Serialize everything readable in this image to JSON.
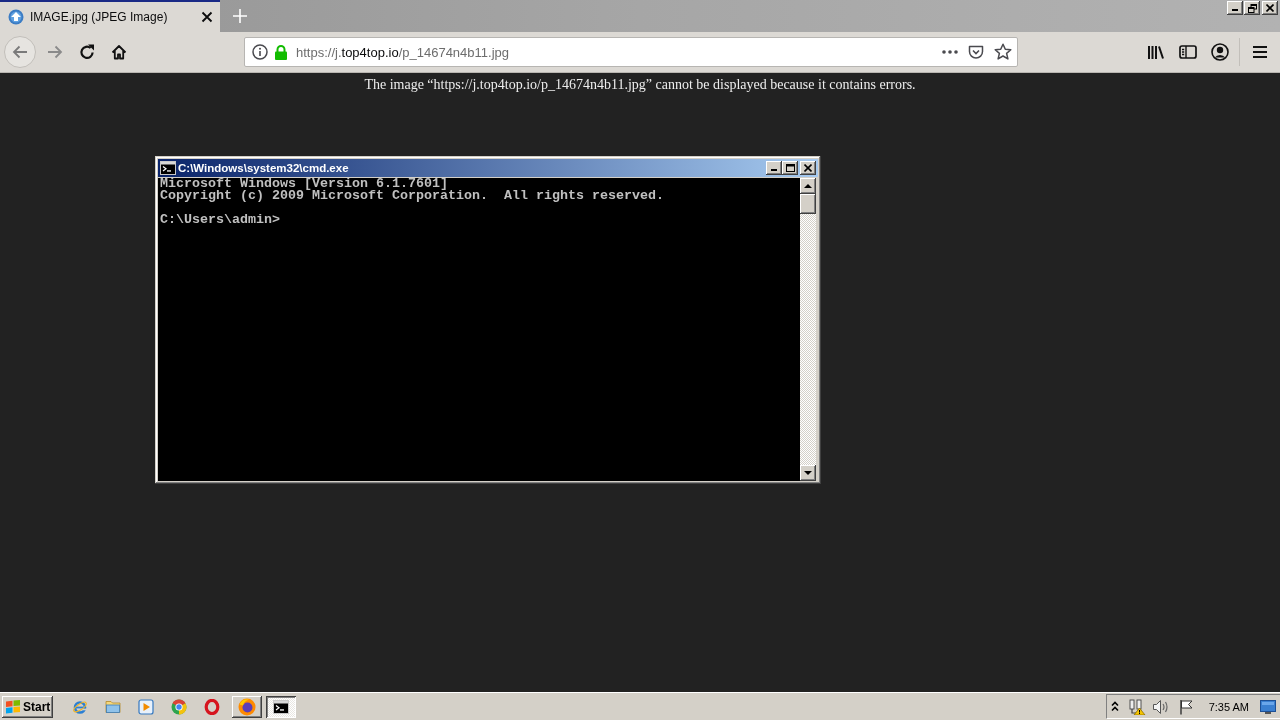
{
  "browser": {
    "tabs": [
      {
        "title": "IMAGE.jpg (JPEG Image)",
        "selected": true
      }
    ],
    "address_bar": {
      "url": {
        "before_domain": "https://j.",
        "domain": "top4top.io",
        "after_domain": "/p_14674n4b11.jpg"
      }
    }
  },
  "page": {
    "message": "The image “https://j.top4top.io/p_14674n4b11.jpg” cannot be displayed because it contains errors."
  },
  "console_window": {
    "title": "C:\\Windows\\system32\\cmd.exe",
    "output": [
      "Microsoft Windows [Version 6.1.7601]",
      "Copyright (c) 2009 Microsoft Corporation.  All rights reserved."
    ],
    "prompt": "C:\\Users\\admin>"
  },
  "taskbar": {
    "start": "Start",
    "task_buttons": [
      {
        "selected": false
      },
      {
        "selected": true
      }
    ],
    "clock": "7:35 AM"
  }
}
